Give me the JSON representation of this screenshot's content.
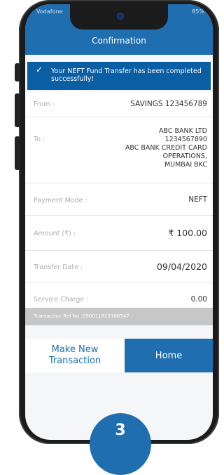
{
  "status_bar": {
    "carrier": "Vodafone",
    "battery": "85%"
  },
  "header": {
    "title": "Confirmation"
  },
  "banner": {
    "message": "Your NEFT Fund Transfer has been completed successfully!"
  },
  "details": {
    "from_label": "From :",
    "from_value": "SAVINGS 123456789",
    "to_label": "To :",
    "to_lines": [
      "ABC BANK  LTD",
      "1234567890",
      "ABC BANK CREDIT CARD",
      "OPERATIONS,",
      "MUMBAI BKC"
    ],
    "payment_mode_label": "Payment Mode :",
    "payment_mode_value": "NEFT",
    "amount_label": "Amount (₹) :",
    "amount_value": "₹ 100.00",
    "transfer_date_label": "Transfer Date :",
    "transfer_date_value": "09/04/2020",
    "service_charge_label": "Service Charge :",
    "service_charge_value": "0.00"
  },
  "reference": {
    "text": "Transaction Ref No :090011823306547"
  },
  "actions": {
    "make_new_label": "Make New Transaction",
    "home_label": "Home"
  },
  "step_badge": {
    "number": "3"
  },
  "colors": {
    "primary": "#1e6eb0",
    "banner": "#0a5ea3",
    "ref_bar": "#c7c7c7"
  }
}
